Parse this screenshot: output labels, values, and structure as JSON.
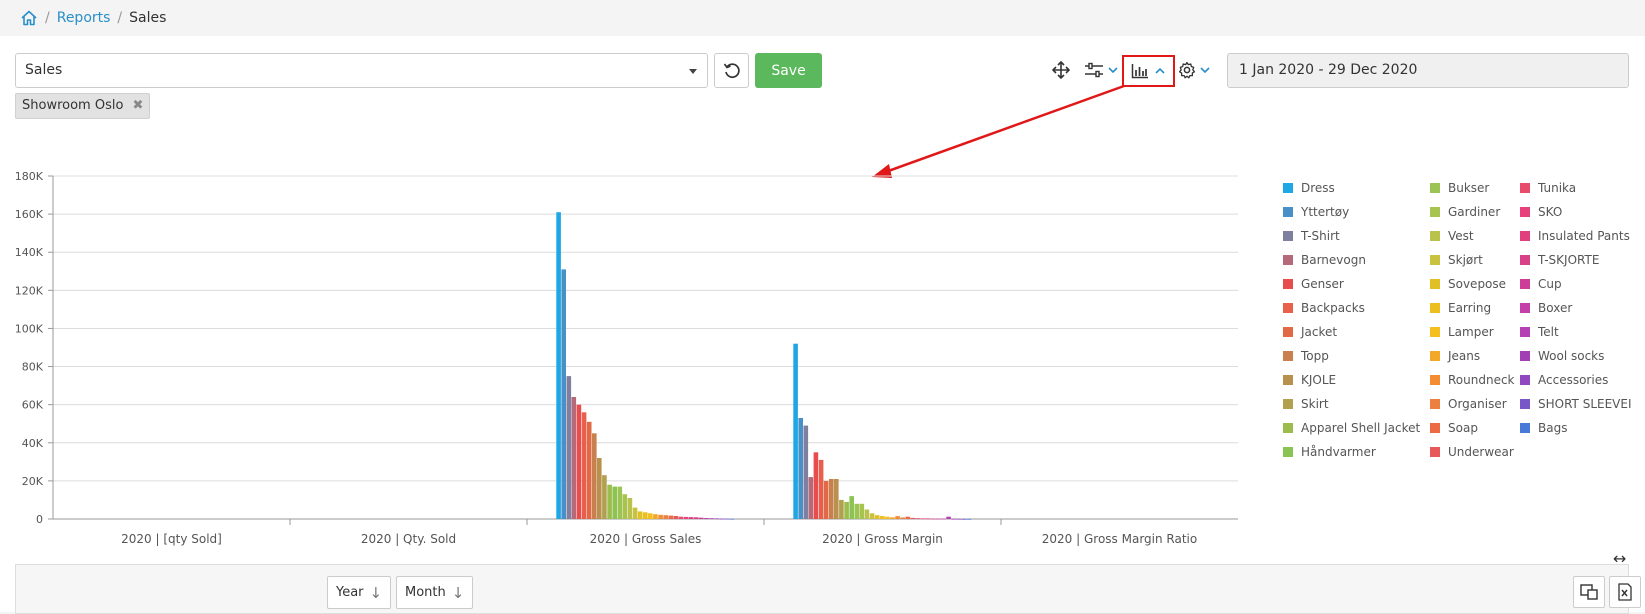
{
  "breadcrumb": {
    "link": "Reports",
    "current": "Sales",
    "separator": "/"
  },
  "toolbar": {
    "report_select_value": "Sales",
    "save_label": "Save",
    "date_range": "1 Jan 2020 - 29 Dec 2020",
    "icons": [
      "home-icon",
      "reset-icon",
      "move-icon",
      "filter-sliders-icon",
      "bar-chart-icon",
      "gear-icon"
    ]
  },
  "filter_tag": {
    "label": "Showroom Oslo",
    "remove": "✖"
  },
  "colors": {
    "save": "#5cb85c",
    "link": "#2a8fc9",
    "highlight": "#e01818"
  },
  "chart_data": {
    "type": "bar",
    "categories": [
      "2020 | [qty Sold]",
      "2020 | Qty. Sold",
      "2020 | Gross Sales",
      "2020 | Gross Margin",
      "2020 | Gross Margin Ratio"
    ],
    "ylim": [
      0,
      180000
    ],
    "yticks": [
      "0",
      "20K",
      "40K",
      "60K",
      "80K",
      "100K",
      "120K",
      "140K",
      "160K",
      "180K"
    ],
    "legend_position": "right",
    "series": [
      {
        "name": "Dress",
        "color": "#1ea7e4",
        "values": [
          0,
          0,
          161000,
          92000,
          0
        ]
      },
      {
        "name": "Yttertøy",
        "color": "#4a90c8",
        "values": [
          0,
          0,
          131000,
          53000,
          0
        ]
      },
      {
        "name": "T-Shirt",
        "color": "#7f7fa0",
        "values": [
          0,
          0,
          75000,
          49000,
          0
        ]
      },
      {
        "name": "Barnevogn",
        "color": "#b56a7a",
        "values": [
          0,
          0,
          64000,
          22000,
          0
        ]
      },
      {
        "name": "Genser",
        "color": "#e84c4c",
        "values": [
          0,
          0,
          60000,
          35000,
          0
        ]
      },
      {
        "name": "Backpacks",
        "color": "#e8604c",
        "values": [
          0,
          0,
          56000,
          31000,
          0
        ]
      },
      {
        "name": "Jacket",
        "color": "#e06a46",
        "values": [
          0,
          0,
          51000,
          20000,
          0
        ]
      },
      {
        "name": "Topp",
        "color": "#c9804e",
        "values": [
          0,
          0,
          45000,
          21000,
          0
        ]
      },
      {
        "name": "KJOLE",
        "color": "#b9914e",
        "values": [
          0,
          0,
          32000,
          21000,
          0
        ]
      },
      {
        "name": "Skirt",
        "color": "#b0a050",
        "values": [
          0,
          0,
          23000,
          10000,
          0
        ]
      },
      {
        "name": "Apparel Shell Jacket",
        "color": "#9cbc4e",
        "values": [
          0,
          0,
          18000,
          9000,
          0
        ]
      },
      {
        "name": "Håndvarmer",
        "color": "#8cc454",
        "values": [
          0,
          0,
          17000,
          12000,
          0
        ]
      },
      {
        "name": "Bukser",
        "color": "#9cc454",
        "values": [
          0,
          0,
          17000,
          8000,
          0
        ]
      },
      {
        "name": "Gardiner",
        "color": "#a8c450",
        "values": [
          0,
          0,
          13000,
          8000,
          0
        ]
      },
      {
        "name": "Vest",
        "color": "#b8c24c",
        "values": [
          0,
          0,
          11000,
          5000,
          0
        ]
      },
      {
        "name": "Skjørt",
        "color": "#c8c23e",
        "values": [
          0,
          0,
          6000,
          3000,
          0
        ]
      },
      {
        "name": "Sovepose",
        "color": "#e0c024",
        "values": [
          0,
          0,
          4000,
          2000,
          0
        ]
      },
      {
        "name": "Earring",
        "color": "#ecbe20",
        "values": [
          0,
          0,
          3500,
          1500,
          0
        ]
      },
      {
        "name": "Lamper",
        "color": "#f4c020",
        "values": [
          0,
          0,
          3000,
          1200,
          0
        ]
      },
      {
        "name": "Jeans",
        "color": "#f4a828",
        "values": [
          0,
          0,
          2500,
          900,
          0
        ]
      },
      {
        "name": "Roundneck",
        "color": "#f48c34",
        "values": [
          0,
          0,
          2200,
          1500,
          0
        ]
      },
      {
        "name": "Organiser",
        "color": "#ec8040",
        "values": [
          0,
          0,
          2000,
          800,
          0
        ]
      },
      {
        "name": "Soap",
        "color": "#ec6a44",
        "values": [
          0,
          0,
          1800,
          1200,
          0
        ]
      },
      {
        "name": "Underwear",
        "color": "#e85858",
        "values": [
          0,
          0,
          1600,
          600,
          0
        ]
      },
      {
        "name": "Tunika",
        "color": "#e84c6a",
        "values": [
          0,
          0,
          1200,
          400,
          0
        ]
      },
      {
        "name": "SKO",
        "color": "#e8407a",
        "values": [
          0,
          0,
          1100,
          300,
          0
        ]
      },
      {
        "name": "Insulated Pants",
        "color": "#e0407e",
        "values": [
          0,
          0,
          1000,
          300,
          0
        ]
      },
      {
        "name": "T-SKJORTE",
        "color": "#d84088",
        "values": [
          0,
          0,
          900,
          200,
          0
        ]
      },
      {
        "name": "Cup",
        "color": "#cc3c98",
        "values": [
          0,
          0,
          700,
          200,
          0
        ]
      },
      {
        "name": "Boxer",
        "color": "#c440a8",
        "values": [
          0,
          0,
          500,
          150,
          0
        ]
      },
      {
        "name": "Telt",
        "color": "#b440b4",
        "values": [
          0,
          0,
          400,
          1200,
          0
        ]
      },
      {
        "name": "Wool socks",
        "color": "#a040b4",
        "values": [
          0,
          0,
          300,
          100,
          0
        ]
      },
      {
        "name": "Accessories",
        "color": "#9048c0",
        "values": [
          0,
          0,
          200,
          100,
          0
        ]
      },
      {
        "name": "SHORT SLEEVEI",
        "color": "#7858c8",
        "values": [
          0,
          0,
          150,
          50,
          0
        ]
      },
      {
        "name": "Bags",
        "color": "#4878d8",
        "values": [
          0,
          0,
          100,
          50,
          0
        ]
      }
    ]
  },
  "pivot": {
    "dimensions": [
      "Year",
      "Month"
    ],
    "sort_glyph": "↓",
    "expand_glyph": "↔"
  }
}
